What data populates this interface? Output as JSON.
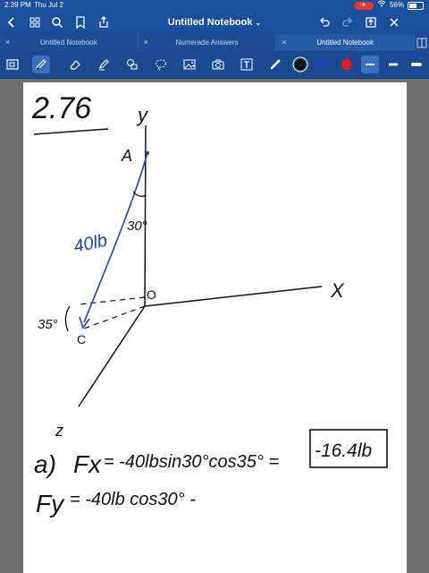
{
  "status_bar": {
    "time": "2:39 PM",
    "date": "Thu Jul 2",
    "battery_percent": "56%",
    "battery_level": 0.56
  },
  "nav": {
    "title": "Untitled Notebook",
    "icons": [
      "chevron-left",
      "grid",
      "search",
      "bookmark",
      "share",
      "undo",
      "redo",
      "export",
      "close"
    ]
  },
  "tabs": [
    {
      "label": "Untitled Notebook",
      "active": false
    },
    {
      "label": "Numerade Answers",
      "active": false
    },
    {
      "label": "Untitled Notebook",
      "active": true
    }
  ],
  "toolbar": {
    "tools": [
      "zoom",
      "pen",
      "eraser",
      "highlighter",
      "shapes",
      "lasso",
      "image",
      "camera",
      "text",
      "laser"
    ],
    "colors": {
      "black": "#111111",
      "blue": "#1e44a8",
      "red": "#e02020"
    },
    "accent": "#1a4f9c"
  },
  "note": {
    "problem_number": "2.76",
    "label_y": "y",
    "label_x": "X",
    "label_z": "z",
    "label_a": "A",
    "label_o": "O",
    "label_c": "C",
    "force": "40lb",
    "angle_30": "30°",
    "angle_35": "35°",
    "part": "a)",
    "fx_lhs": "Fx",
    "fx_rhs": "= -40lbsin30°cos35° =",
    "fx_answer": "-16.4lb",
    "fy_lhs": "Fy",
    "fy_rhs": "= -40lb cos30° -"
  }
}
